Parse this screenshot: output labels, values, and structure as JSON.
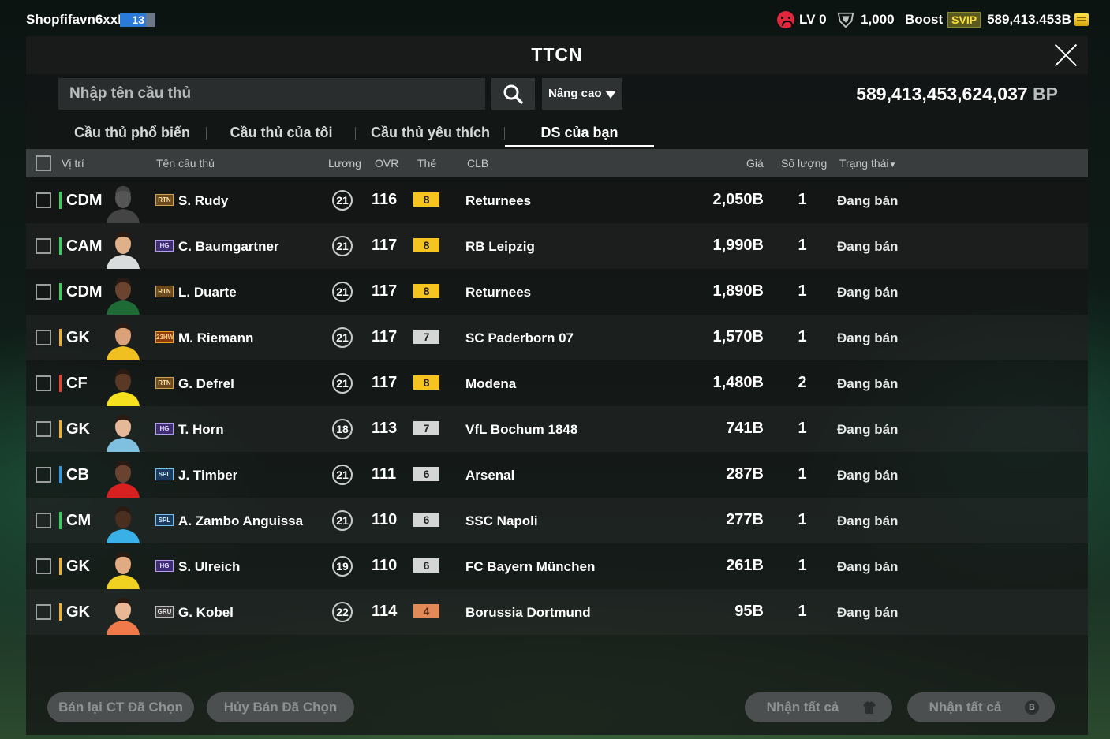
{
  "topbar": {
    "username": "Shopfifavn6xxR",
    "user_level": "13",
    "lv_label": "LV 0",
    "points": "1,000",
    "boost_label": "Boost",
    "svip_label": "SVIP",
    "bp_short": "589,413.453B"
  },
  "panel": {
    "title": "TTCN",
    "search_placeholder": "Nhập tên cầu thủ",
    "advanced_label": "Nâng cao",
    "bp_total_value": "589,413,453,624,037",
    "bp_unit": "BP"
  },
  "tabs": [
    {
      "label": "Cầu thủ phổ biến",
      "active": false
    },
    {
      "label": "Cầu thủ của tôi",
      "active": false
    },
    {
      "label": "Cầu thủ yêu thích",
      "active": false
    },
    {
      "label": "DS của bạn",
      "active": true
    }
  ],
  "columns": {
    "position": "Vị trí",
    "name": "Tên cầu thủ",
    "salary": "Lương",
    "ovr": "OVR",
    "card": "Thẻ",
    "club": "CLB",
    "price": "Giá",
    "qty": "Số lượng",
    "status": "Trạng thái"
  },
  "players": [
    {
      "pos": "CDM",
      "season": "RTN",
      "name": "S. Rudy",
      "salary": "21",
      "ovr": "116",
      "card": "8",
      "club": "Returnees",
      "price": "2,050B",
      "qty": "1",
      "status": "Đang bán"
    },
    {
      "pos": "CAM",
      "season": "HG",
      "name": "C. Baumgartner",
      "salary": "21",
      "ovr": "117",
      "card": "8",
      "club": "RB Leipzig",
      "price": "1,990B",
      "qty": "1",
      "status": "Đang bán"
    },
    {
      "pos": "CDM",
      "season": "RTN",
      "name": "L. Duarte",
      "salary": "21",
      "ovr": "117",
      "card": "8",
      "club": "Returnees",
      "price": "1,890B",
      "qty": "1",
      "status": "Đang bán"
    },
    {
      "pos": "GK",
      "season": "23HW",
      "name": "M. Riemann",
      "salary": "21",
      "ovr": "117",
      "card": "7",
      "club": "SC Paderborn 07",
      "price": "1,570B",
      "qty": "1",
      "status": "Đang bán"
    },
    {
      "pos": "CF",
      "season": "RTN",
      "name": "G. Defrel",
      "salary": "21",
      "ovr": "117",
      "card": "8",
      "club": "Modena",
      "price": "1,480B",
      "qty": "2",
      "status": "Đang bán"
    },
    {
      "pos": "GK",
      "season": "HG",
      "name": "T. Horn",
      "salary": "18",
      "ovr": "113",
      "card": "7",
      "club": "VfL Bochum 1848",
      "price": "741B",
      "qty": "1",
      "status": "Đang bán"
    },
    {
      "pos": "CB",
      "season": "SPL",
      "name": "J. Timber",
      "salary": "21",
      "ovr": "111",
      "card": "6",
      "club": "Arsenal",
      "price": "287B",
      "qty": "1",
      "status": "Đang bán"
    },
    {
      "pos": "CM",
      "season": "SPL",
      "name": "A. Zambo Anguissa",
      "salary": "21",
      "ovr": "110",
      "card": "6",
      "club": "SSC Napoli",
      "price": "277B",
      "qty": "1",
      "status": "Đang bán"
    },
    {
      "pos": "GK",
      "season": "HG",
      "name": "S. Ulreich",
      "salary": "19",
      "ovr": "110",
      "card": "6",
      "club": "FC Bayern München",
      "price": "261B",
      "qty": "1",
      "status": "Đang bán"
    },
    {
      "pos": "GK",
      "season": "GRU",
      "name": "G. Kobel",
      "salary": "22",
      "ovr": "114",
      "card": "4",
      "club": "Borussia Dortmund",
      "price": "95B",
      "qty": "1",
      "status": "Đang bán"
    }
  ],
  "buttons": {
    "resell_selected": "Bán lại CT Đã Chọn",
    "cancel_selected": "Hủy Bán Đã Chọn",
    "receive_all_1": "Nhận tất cả",
    "receive_all_2": "Nhận tất cả",
    "receive_all_2_icon": "B"
  }
}
